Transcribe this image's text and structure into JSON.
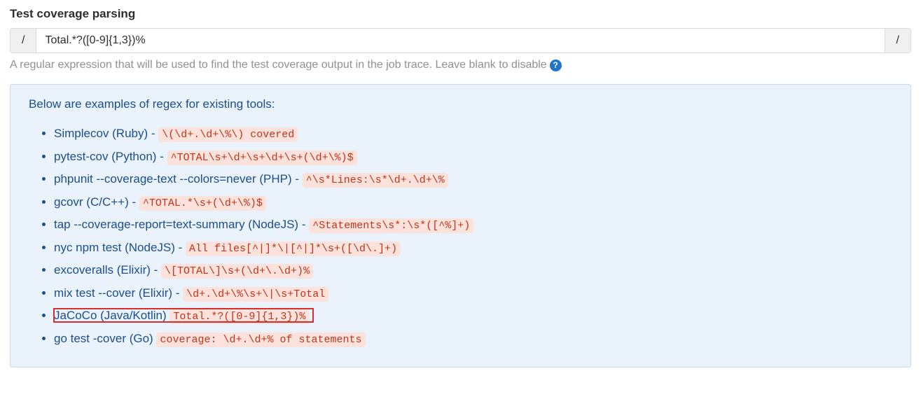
{
  "section": {
    "label": "Test coverage parsing",
    "input_value": "Total.*?([0-9]{1,3})%",
    "prefix": "/",
    "suffix": "/",
    "help_text": "A regular expression that will be used to find the test coverage output in the job trace. Leave blank to disable",
    "help_icon_glyph": "?"
  },
  "examples_title": "Below are examples of regex for existing tools:",
  "examples": [
    {
      "tool": "Simplecov (Ruby)",
      "regex": "\\(\\d+.\\d+\\%\\) covered",
      "sep": " - ",
      "highlighted": false
    },
    {
      "tool": "pytest-cov (Python)",
      "regex": "^TOTAL\\s+\\d+\\s+\\d+\\s+(\\d+\\%)$",
      "sep": " - ",
      "highlighted": false
    },
    {
      "tool": "phpunit --coverage-text --colors=never (PHP)",
      "regex": "^\\s*Lines:\\s*\\d+.\\d+\\%",
      "sep": " - ",
      "highlighted": false
    },
    {
      "tool": "gcovr (C/C++)",
      "regex": "^TOTAL.*\\s+(\\d+\\%)$",
      "sep": " - ",
      "highlighted": false
    },
    {
      "tool": "tap --coverage-report=text-summary (NodeJS)",
      "regex": "^Statements\\s*:\\s*([^%]+)",
      "sep": " - ",
      "highlighted": false
    },
    {
      "tool": "nyc npm test (NodeJS)",
      "regex": "All files[^|]*\\|[^|]*\\s+([\\d\\.]+)",
      "sep": " - ",
      "highlighted": false
    },
    {
      "tool": "excoveralls (Elixir)",
      "regex": "\\[TOTAL\\]\\s+(\\d+\\.\\d+)%",
      "sep": " - ",
      "highlighted": false
    },
    {
      "tool": "mix test --cover (Elixir)",
      "regex": "\\d+.\\d+\\%\\s+\\|\\s+Total",
      "sep": " - ",
      "highlighted": false
    },
    {
      "tool": "JaCoCo (Java/Kotlin)",
      "regex": "Total.*?([0-9]{1,3})%",
      "sep": " ",
      "highlighted": true
    },
    {
      "tool": "go test -cover (Go)",
      "regex": "coverage: \\d+.\\d+% of statements",
      "sep": " ",
      "highlighted": false
    }
  ]
}
